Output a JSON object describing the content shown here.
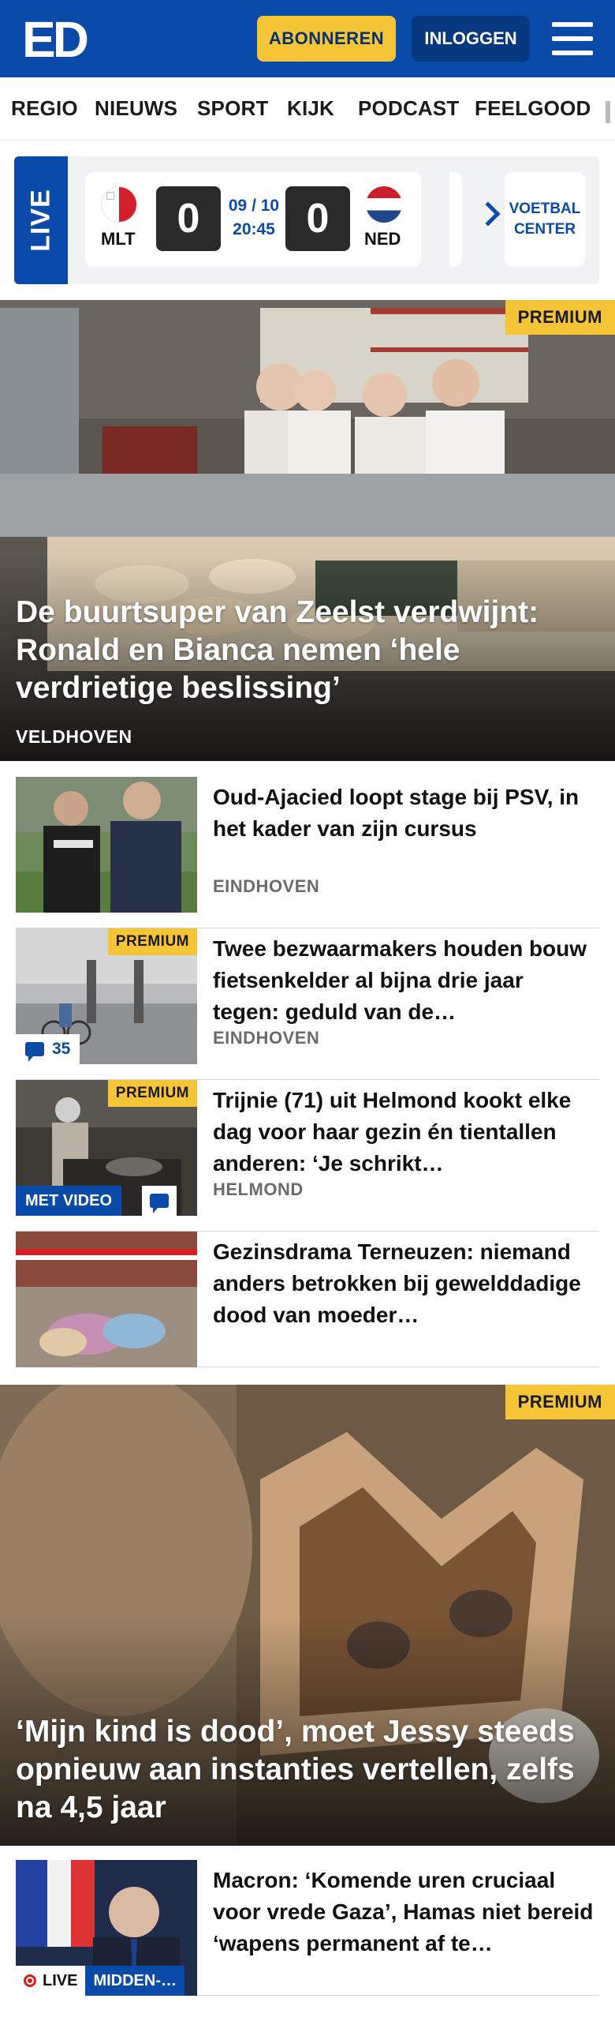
{
  "header": {
    "logo": "ED",
    "subscribe_label": "ABONNEREN",
    "login_label": "INLOGGEN"
  },
  "nav": {
    "items": [
      "REGIO",
      "NIEUWS",
      "SPORT",
      "KIJK",
      "PODCAST",
      "FEELGOOD"
    ]
  },
  "livebar": {
    "live_label": "LIVE",
    "match": {
      "home_team": "MLT",
      "away_team": "NED",
      "home_score": "0",
      "away_score": "0",
      "date": "09 / 10",
      "time": "20:45"
    },
    "voetbal_center_label": "VOETBAL CENTER"
  },
  "hero1": {
    "premium_label": "PREMIUM",
    "title": "De buurtsuper van Zeelst verdwijnt: Ronald en Bianca nemen ‘hele verdrietige beslissing’",
    "location": "VELDHOVEN"
  },
  "articles": [
    {
      "title": "Oud-Ajacied loopt stage bij PSV, in het kader van zijn cursus",
      "location": "EINDHOVEN"
    },
    {
      "premium_label": "PREMIUM",
      "comments": "35",
      "title": "Twee bezwaarmakers houden bouw fietsenkelder al bijna drie jaar tegen: geduld van de…",
      "location": "EINDHOVEN"
    },
    {
      "premium_label": "PREMIUM",
      "video_label": "MET VIDEO",
      "title": "Trijnie (71) uit Helmond kookt elke dag voor haar gezin én tientallen anderen: ‘Je schrikt…",
      "location": "HELMOND"
    },
    {
      "title": "Gezinsdrama Terneuzen: niemand anders betrokken bij gewelddadige dood van moeder…"
    }
  ],
  "hero2": {
    "premium_label": "PREMIUM",
    "title": "‘Mijn kind is dood’, moet Jessy steeds opnieuw aan instanties vertellen, zelfs na 4,5 jaar"
  },
  "article_macron": {
    "title": "Macron: ‘Komende uren cruciaal voor vrede Gaza’, Hamas niet bereid ‘wapens permanent af te…",
    "live_label": "LIVE",
    "topic_label": "MIDDEN-…"
  }
}
